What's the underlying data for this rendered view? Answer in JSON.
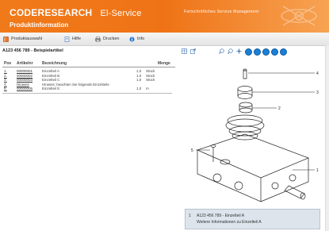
{
  "header": {
    "brand_code": "CODE",
    "brand_research": "RESEARCH",
    "brand_service": "El-Service",
    "subtitle": "Produktinformation",
    "tagline": "Fortschrittliches Service Management"
  },
  "toolbar": {
    "items": [
      {
        "label": "Produktauswahl",
        "icon": "book-icon"
      },
      {
        "label": "Hilfe",
        "icon": "help-document-icon"
      },
      {
        "label": "Drucken",
        "icon": "print-icon"
      },
      {
        "label": "Info",
        "icon": "info-icon"
      }
    ]
  },
  "panel": {
    "title": "A123 456 789 - Beispielartikel"
  },
  "parts": {
    "columns": [
      "Pos",
      "Artikelnr",
      "Bezeichnung",
      "Menge"
    ],
    "rows": [
      {
        "pos": "1.",
        "art": "00000001",
        "desc": "Einzelteil A",
        "qty": "1,0",
        "unit": "Stück"
      },
      {
        "pos": "2.",
        "art": "00000002",
        "desc": "Einzelteil B",
        "qty": "1,0",
        "unit": "Stück"
      },
      {
        "pos": "3.",
        "art": "00000003",
        "desc": "Einzelteil C",
        "qty": "1,0",
        "unit": "Stück"
      },
      {
        "pos": "4.",
        "art": "Hinweis",
        "desc": "Hinweis: beachten Sie folgende Einzelteile",
        "qty": "",
        "unit": ""
      },
      {
        "pos": "5.",
        "art": "00000005",
        "desc": "Einzelteil E",
        "qty": "1,0",
        "unit": "m"
      }
    ]
  },
  "viewer": {
    "tools": [
      "table-icon",
      "export-icon",
      "zoom-in-icon",
      "zoom-out-icon",
      "pan-icon"
    ],
    "nav": [
      "nav-first-icon",
      "nav-prev-icon",
      "nav-next-icon",
      "nav-last-icon",
      "nav-end-icon"
    ]
  },
  "callouts": [
    "4",
    "3",
    "2",
    "5",
    "1"
  ],
  "info": {
    "number": "1",
    "line1": "A123 456 789 - Einzelteil A",
    "line2": "Weitere Informationen zu Einzelteil A"
  },
  "colors": {
    "header_orange": "#f07a1a",
    "accent_blue": "#1c7fd6",
    "info_bg": "#dde4ec"
  }
}
